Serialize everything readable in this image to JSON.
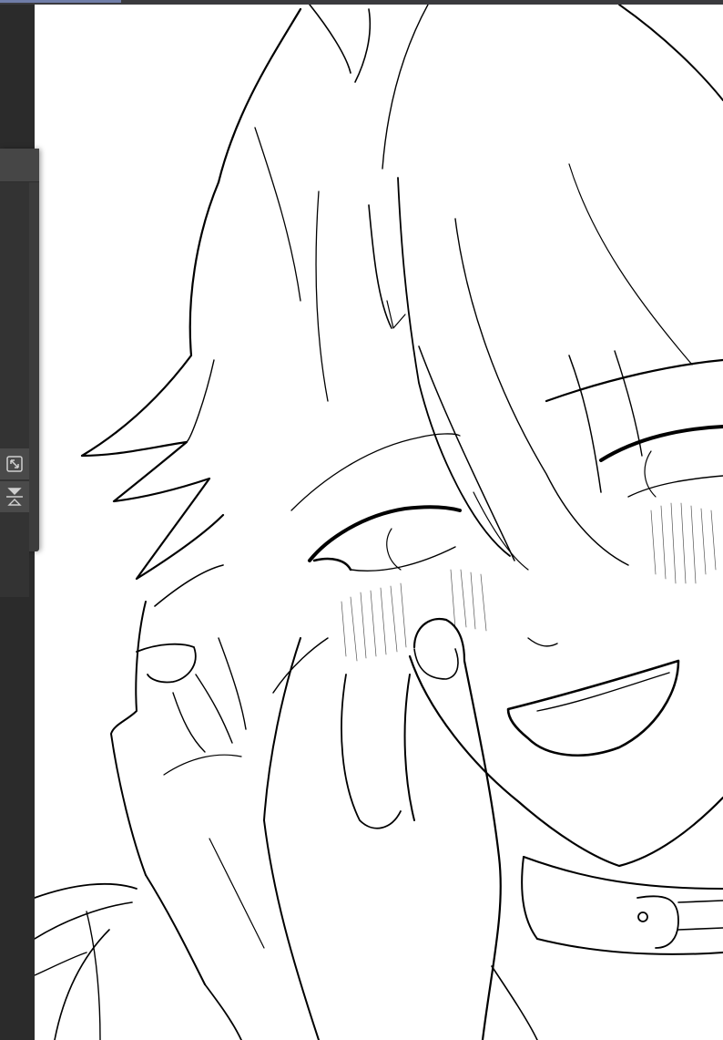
{
  "app": {
    "accent_color": "#6f7da8",
    "background_color": "#2b2b2b"
  },
  "canvas": {
    "content": "line-art-illustration",
    "background": "#ffffff",
    "stroke_color": "#000000"
  },
  "floating_palette": {
    "tools": [
      {
        "icon": "resize-icon"
      },
      {
        "icon": "flip-vertical-icon"
      }
    ]
  }
}
